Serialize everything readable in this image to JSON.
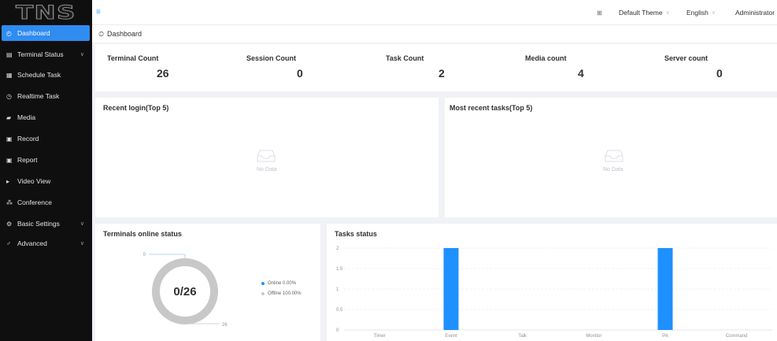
{
  "logo": {
    "text": "TNS"
  },
  "sidebar": {
    "items": [
      {
        "label": "Dashboard",
        "icon": "dashboard-icon",
        "glyph": "◴",
        "active": true,
        "chevron": false
      },
      {
        "label": "Terminal Status",
        "icon": "monitor-icon",
        "glyph": "▤",
        "active": false,
        "chevron": true
      },
      {
        "label": "Schedule Task",
        "icon": "calendar-icon",
        "glyph": "▦",
        "active": false,
        "chevron": false
      },
      {
        "label": "Realtime Task",
        "icon": "clock-icon",
        "glyph": "◷",
        "active": false,
        "chevron": false
      },
      {
        "label": "Media",
        "icon": "media-icon",
        "glyph": "▰",
        "active": false,
        "chevron": false
      },
      {
        "label": "Record",
        "icon": "record-icon",
        "glyph": "▣",
        "active": false,
        "chevron": false
      },
      {
        "label": "Report",
        "icon": "report-icon",
        "glyph": "▣",
        "active": false,
        "chevron": false
      },
      {
        "label": "Video View",
        "icon": "video-icon",
        "glyph": "▸",
        "active": false,
        "chevron": false
      },
      {
        "label": "Conference",
        "icon": "conference-icon",
        "glyph": "⁂",
        "active": false,
        "chevron": false
      },
      {
        "label": "Basic Settings",
        "icon": "gear-icon",
        "glyph": "⚙",
        "active": false,
        "chevron": true
      },
      {
        "label": "Advanced",
        "icon": "advanced-icon",
        "glyph": "♂",
        "active": false,
        "chevron": true
      }
    ]
  },
  "topbar": {
    "menu_glyph": "≡",
    "fullscreen_glyph": "⊞",
    "theme": "Default Theme",
    "language": "English",
    "user": "Administrator",
    "caret": "∨"
  },
  "breadcrumb": {
    "glyph": "⏲",
    "label": "Dashboard"
  },
  "stats": [
    {
      "label": "Terminal Count",
      "value": "26"
    },
    {
      "label": "Session Count",
      "value": "0"
    },
    {
      "label": "Task Count",
      "value": "2"
    },
    {
      "label": "Media count",
      "value": "4"
    },
    {
      "label": "Server count",
      "value": "0"
    }
  ],
  "cards": {
    "recent_login": {
      "title": "Recent login(Top 5)",
      "empty_text": "No Data"
    },
    "recent_tasks": {
      "title": "Most recent tasks(Top 5)",
      "empty_text": "No Data"
    },
    "terminals_online": {
      "title": "Terminals online status",
      "center_text": "0/26",
      "label_online_count": "0",
      "label_offline_count": "26",
      "legend": [
        {
          "label": "Online 0.00%",
          "color": "#1e90ff"
        },
        {
          "label": "Offline 100.00%",
          "color": "#c8c8c8"
        }
      ]
    },
    "tasks_status": {
      "title": "Tasks status"
    }
  },
  "chart_data": [
    {
      "type": "pie",
      "title": "Terminals online status",
      "categories": [
        "Online",
        "Offline"
      ],
      "values": [
        0,
        26
      ],
      "colors": [
        "#1e90ff",
        "#c8c8c8"
      ],
      "center_text": "0/26"
    },
    {
      "type": "bar",
      "title": "Tasks status",
      "categories": [
        "Timer",
        "Event",
        "Talk",
        "Monitor",
        "PA",
        "Command"
      ],
      "values": [
        0,
        2,
        0,
        0,
        2,
        0
      ],
      "ylim": [
        0,
        2
      ],
      "yticks": [
        "0",
        "0.5",
        "1",
        "1.5",
        "2"
      ],
      "bar_color": "#1e90ff",
      "grid": true
    }
  ],
  "colors": {
    "accent": "#2f8cf0",
    "sidebar_bg": "#0f0f0f",
    "bar": "#1e90ff"
  }
}
